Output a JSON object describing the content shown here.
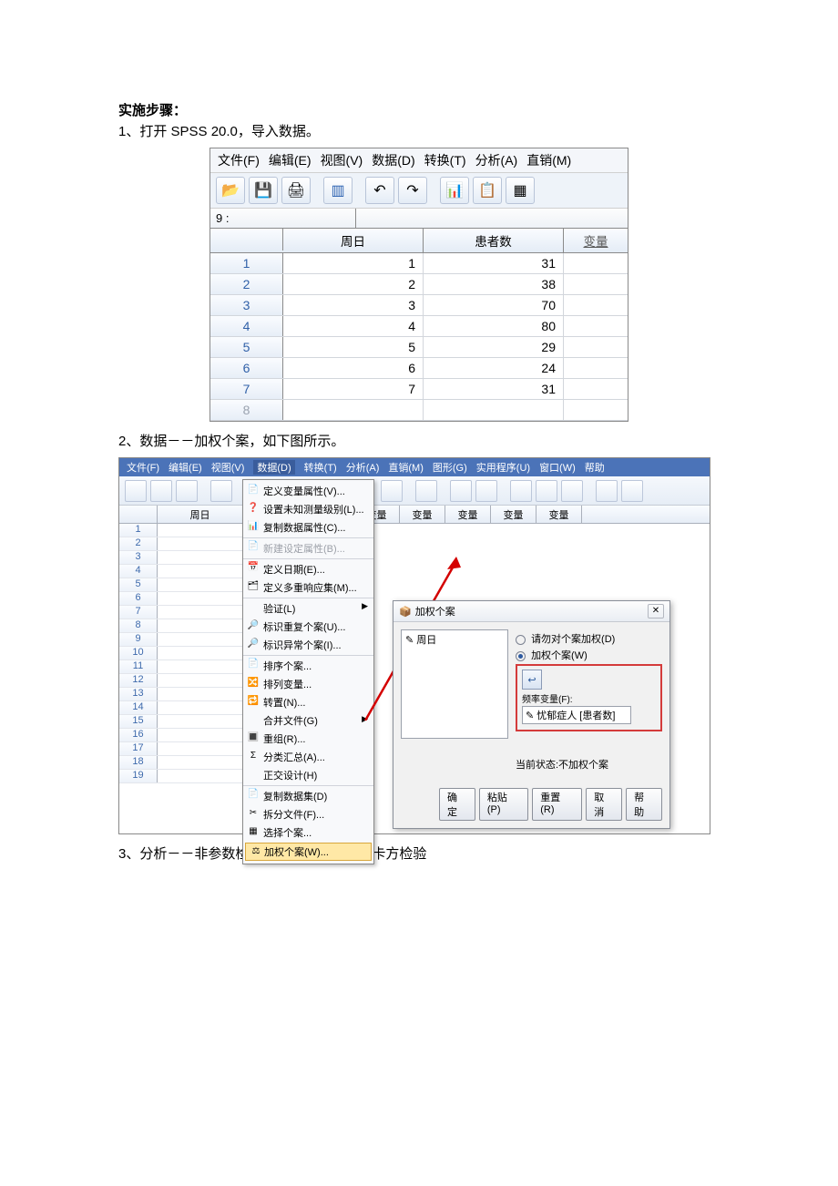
{
  "section_title": "实施步骤：",
  "step1_text": "1、打开 SPSS 20.0，导入数据。",
  "step2_text": "2、数据－－加权个案，如下图所示。",
  "step3_text": "3、分析－－非参数检验－－旧对话框－－卡方检验",
  "shot1": {
    "menu": {
      "file": "文件(F)",
      "edit": "编辑(E)",
      "view": "视图(V)",
      "data": "数据(D)",
      "transform": "转换(T)",
      "analyze": "分析(A)",
      "direct": "直销(M)"
    },
    "selection_label": "9 :",
    "columns": {
      "c1": "周日",
      "c2": "患者数",
      "c3": "变量"
    },
    "rows": [
      {
        "n": "1",
        "day": "1",
        "count": "31"
      },
      {
        "n": "2",
        "day": "2",
        "count": "38"
      },
      {
        "n": "3",
        "day": "3",
        "count": "70"
      },
      {
        "n": "4",
        "day": "4",
        "count": "80"
      },
      {
        "n": "5",
        "day": "5",
        "count": "29"
      },
      {
        "n": "6",
        "day": "6",
        "count": "24"
      },
      {
        "n": "7",
        "day": "7",
        "count": "31"
      },
      {
        "n": "8",
        "day": "",
        "count": ""
      }
    ]
  },
  "shot2": {
    "menu": {
      "file": "文件(F)",
      "edit": "编辑(E)",
      "view": "视图(V)",
      "data": "数据(D)",
      "transform": "转换(T)",
      "analyze": "分析(A)",
      "direct": "直销(M)",
      "graphs": "图形(G)",
      "util": "实用程序(U)",
      "window": "窗口(W)",
      "help": "帮助"
    },
    "left_header": "周日",
    "right_colhead": "变量",
    "right_firstcol": "量",
    "data_menu_items": [
      {
        "icon": "📄",
        "label": "定义变量属性(V)...",
        "disabled": false
      },
      {
        "icon": "❓",
        "label": "设置未知测量级别(L)...",
        "disabled": false
      },
      {
        "icon": "📊",
        "label": "复制数据属性(C)...",
        "disabled": false
      },
      {
        "icon": "📄",
        "label": "新建设定属性(B)...",
        "disabled": true,
        "sep": true
      },
      {
        "icon": "📅",
        "label": "定义日期(E)...",
        "disabled": false,
        "sep": true
      },
      {
        "icon": "🗂",
        "label": "定义多重响应集(M)...",
        "disabled": false
      },
      {
        "icon": "",
        "label": "验证(L)",
        "submenu": true,
        "sep": true
      },
      {
        "icon": "🔎",
        "label": "标识重复个案(U)...",
        "disabled": false
      },
      {
        "icon": "🔎",
        "label": "标识异常个案(I)...",
        "disabled": false
      },
      {
        "icon": "📄",
        "label": "排序个案...",
        "disabled": false,
        "sep": true
      },
      {
        "icon": "🔀",
        "label": "排列变量...",
        "disabled": false
      },
      {
        "icon": "🔁",
        "label": "转置(N)...",
        "disabled": false
      },
      {
        "icon": "",
        "label": "合并文件(G)",
        "submenu": true
      },
      {
        "icon": "🔳",
        "label": "重组(R)...",
        "disabled": false
      },
      {
        "icon": "Σ",
        "label": "分类汇总(A)...",
        "disabled": false
      },
      {
        "icon": "",
        "label": "正交设计(H)",
        "disabled": false
      },
      {
        "icon": "📄",
        "label": "复制数据集(D)",
        "disabled": false,
        "sep": true
      },
      {
        "icon": "✂",
        "label": "拆分文件(F)...",
        "disabled": false
      },
      {
        "icon": "▦",
        "label": "选择个案...",
        "disabled": false
      },
      {
        "icon": "⚖",
        "label": "加权个案(W)...",
        "highlight": true,
        "sep": true
      }
    ],
    "dialog": {
      "title": "加权个案",
      "var_in_list": "周日",
      "radio_off": "请勿对个案加权(D)",
      "radio_on": "加权个案(W)",
      "freq_label": "频率变量(F):",
      "freq_value": "忧郁症人 [患者数]",
      "status": "当前状态:不加权个案",
      "buttons": {
        "ok": "确定",
        "paste": "粘贴(P)",
        "reset": "重置(R)",
        "cancel": "取消",
        "help": "帮助"
      }
    }
  }
}
